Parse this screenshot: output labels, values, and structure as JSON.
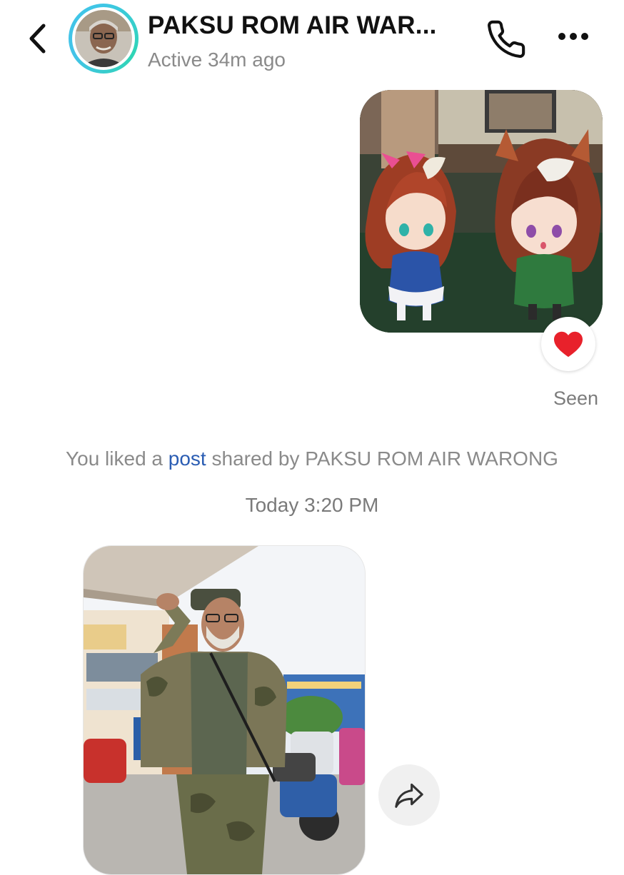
{
  "header": {
    "contact_name": "PAKSU ROM AIR WAR...",
    "status": "Active 34m ago",
    "back_icon": "chevron-left-icon",
    "call_icon": "phone-icon",
    "more_icon": "more-horizontal-icon",
    "ring_color": "#3fc6e6"
  },
  "messages": {
    "sent_media": {
      "kind": "anime-chibi-characters-image"
    },
    "reaction": {
      "icon": "heart-icon",
      "color": "#e8212b"
    },
    "seen_label": "Seen",
    "system_message": {
      "prefix": "You liked a ",
      "link_text": "post",
      "suffix": " shared by PAKSU ROM AIR WARONG",
      "link_color": "#2b5db3"
    },
    "timestamp": "Today 3:20 PM",
    "received_media": {
      "kind": "man-saluting-photo",
      "share_icon": "share-arrow-icon"
    }
  }
}
